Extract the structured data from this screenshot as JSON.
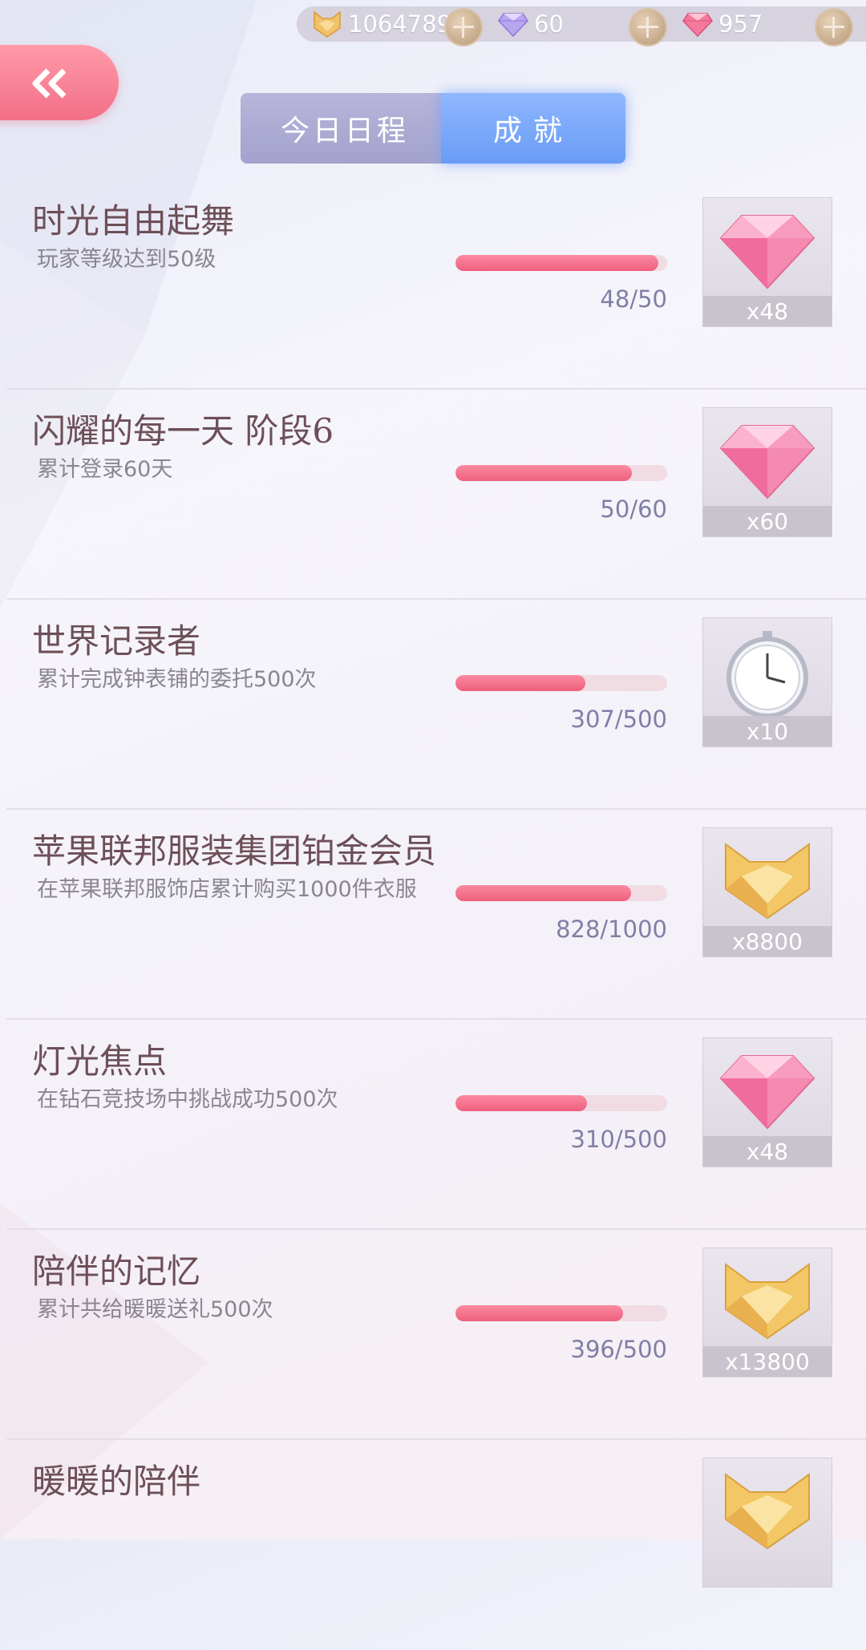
{
  "currency": {
    "gold": "1064789",
    "diamond": "60",
    "gem": "957"
  },
  "tabs": {
    "today": "今日日程",
    "achievement": "成就"
  },
  "achievements": [
    {
      "title": "时光自由起舞",
      "desc": "玩家等级达到50级",
      "current": 48,
      "total": 50,
      "progress_text": "48/50",
      "reward_icon": "pink-diamond-icon",
      "reward_count": "x48"
    },
    {
      "title": "闪耀的每一天 阶段6",
      "desc": "累计登录60天",
      "current": 50,
      "total": 60,
      "progress_text": "50/60",
      "reward_icon": "pink-diamond-icon",
      "reward_count": "x60"
    },
    {
      "title": "世界记录者",
      "desc": "累计完成钟表铺的委托500次",
      "current": 307,
      "total": 500,
      "progress_text": "307/500",
      "reward_icon": "pocket-watch-icon",
      "reward_count": "x10"
    },
    {
      "title": "苹果联邦服装集团铂金会员",
      "desc": "在苹果联邦服饰店累计购买1000件衣服",
      "current": 828,
      "total": 1000,
      "progress_text": "828/1000",
      "reward_icon": "gold-coin-icon",
      "reward_count": "x8800"
    },
    {
      "title": "灯光焦点",
      "desc": "在钻石竞技场中挑战成功500次",
      "current": 310,
      "total": 500,
      "progress_text": "310/500",
      "reward_icon": "pink-diamond-icon",
      "reward_count": "x48"
    },
    {
      "title": "陪伴的记忆",
      "desc": "累计共给暖暖送礼500次",
      "current": 396,
      "total": 500,
      "progress_text": "396/500",
      "reward_icon": "gold-coin-icon",
      "reward_count": "x13800"
    },
    {
      "title": "暖暖的陪伴",
      "desc": "",
      "current": 0,
      "total": 0,
      "progress_text": "",
      "reward_icon": "gold-coin-icon",
      "reward_count": ""
    }
  ],
  "colors": {
    "accent_pink": "#ee5f7d",
    "tab_active": "#6a9bf5",
    "title_text": "#6d4f57"
  }
}
